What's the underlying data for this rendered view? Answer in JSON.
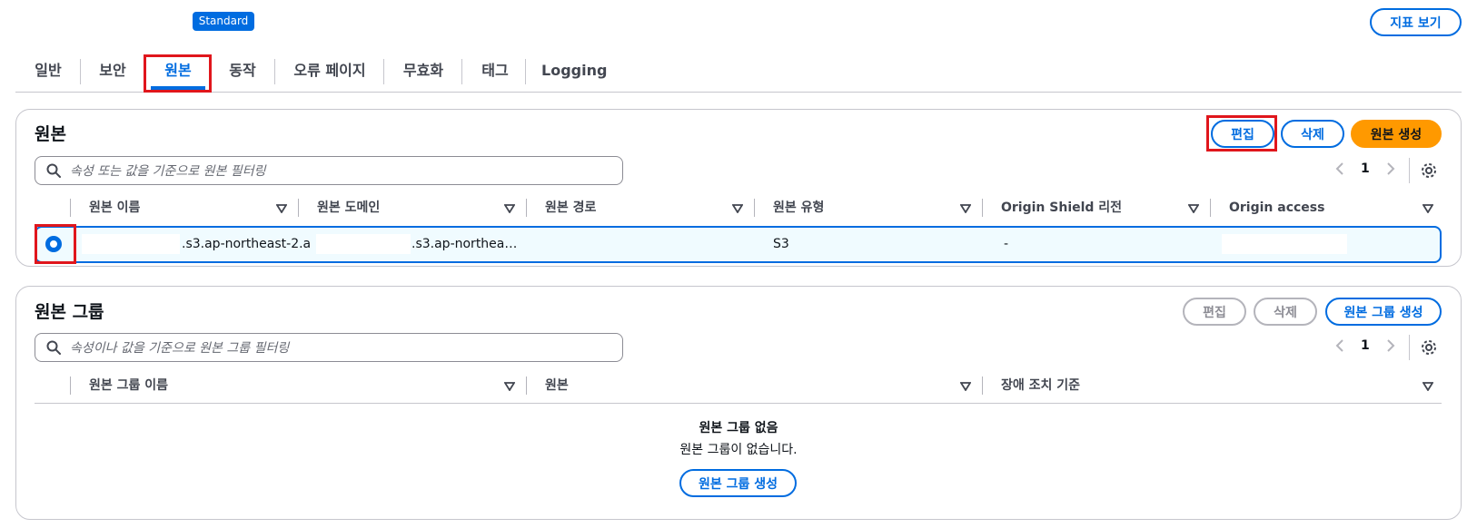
{
  "header": {
    "badge": "Standard",
    "metrics_button": "지표 보기"
  },
  "tabs": [
    {
      "label": "일반"
    },
    {
      "label": "보안"
    },
    {
      "label": "원본"
    },
    {
      "label": "동작"
    },
    {
      "label": "오류 페이지"
    },
    {
      "label": "무효화"
    },
    {
      "label": "태그"
    },
    {
      "label": "Logging"
    }
  ],
  "active_tab": "원본",
  "origins": {
    "title": "원본",
    "edit_button": "편집",
    "delete_button": "삭제",
    "create_button": "원본 생성",
    "search_placeholder": "속성 또는 값을 기준으로 원본 필터링",
    "page": "1",
    "columns": [
      "원본 이름",
      "원본 도메인",
      "원본 경로",
      "원본 유형",
      "Origin Shield 리전",
      "Origin access"
    ],
    "rows": [
      {
        "name": ".s3.ap-northeast-2.a",
        "domain": ".s3.ap-northea…",
        "path": "",
        "type": "S3",
        "shield_region": "-",
        "access": ""
      }
    ]
  },
  "origin_groups": {
    "title": "원본 그룹",
    "edit_button": "편집",
    "delete_button": "삭제",
    "create_button": "원본 그룹 생성",
    "search_placeholder": "속성이나 값을 기준으로 원본 그룹 필터링",
    "page": "1",
    "columns": [
      "원본 그룹 이름",
      "원본",
      "장애 조치 기준"
    ],
    "empty_title": "원본 그룹 없음",
    "empty_desc": "원본 그룹이 없습니다.",
    "empty_create_button": "원본 그룹 생성"
  },
  "colors": {
    "accent": "#006ce0",
    "primary_button": "#ff9900",
    "highlight": "#e0161c"
  }
}
